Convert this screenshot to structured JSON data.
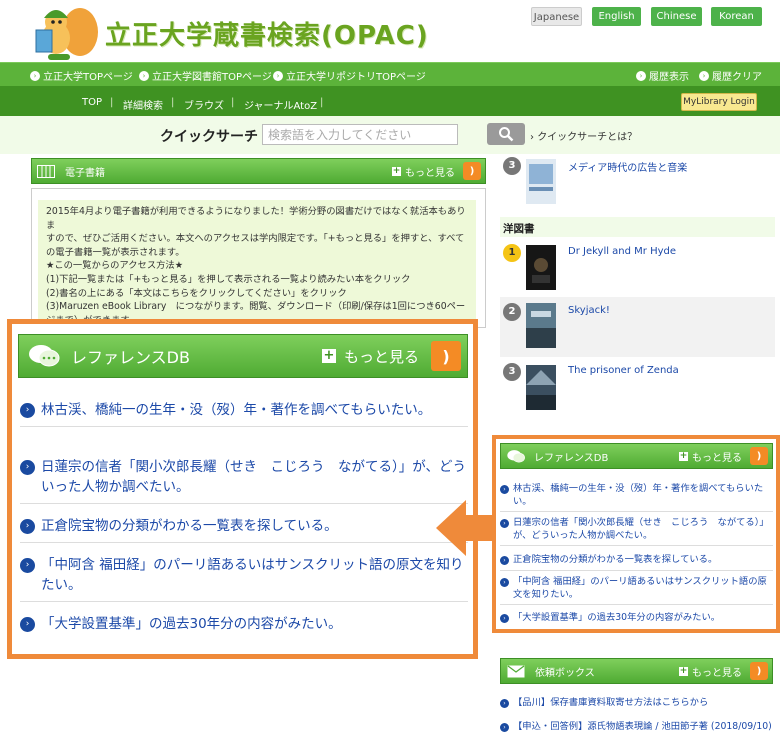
{
  "header": {
    "title": "立正大学蔵書検索(OPAC)",
    "languages": [
      "Japanese",
      "English",
      "Chinese",
      "Korean"
    ],
    "top_links": [
      "立正大学TOPページ",
      "立正大学図書館TOPページ",
      "立正大学リポジトリTOPページ"
    ],
    "right_links": [
      "履歴表示",
      "履歴クリア"
    ],
    "nav": [
      "TOP",
      "詳細検索",
      "ブラウズ",
      "ジャーナルAtoZ"
    ],
    "mylibrary": "MyLibrary Login"
  },
  "quick_search": {
    "label": "クイックサーチ",
    "placeholder": "検索語を入力してください",
    "about": "クイックサーチとは？"
  },
  "ebook": {
    "title": "電子書籍",
    "more": "もっと見る",
    "lines": [
      "2015年4月より電子書籍が利用できるようになりました！学術分野の図書だけではなく就活本もありま",
      "すので、ぜひご活用ください。本文へのアクセスは学内限定です。「+もっと見る」を押すと、すべて",
      "の電子書籍一覧が表示されます。",
      "★この一覧からのアクセス方法★",
      "(1)下記一覧または「+もっと見る」を押して表示される一覧より読みたい本をクリック",
      "(2)書名の上にある「本文はこちらをクリックしてください」をクリック",
      "(3)Maruzen eBook Library　につながります。閲覧、ダウンロード（印刷/保存は1回につき60ペー",
      "ジまで）ができます。"
    ]
  },
  "reference": {
    "title": "レファレンスDB",
    "more": "もっと見る",
    "items": [
      "林古渓、橋純一の生年・没（歿）年・著作を調べてもらいたい。",
      "日蓮宗の信者「関小次郎長耀（せき　こじろう　ながてる）」が、どういった人物か調べたい。",
      "正倉院宝物の分類がわかる一覧表を探している。",
      "「中阿含 福田経」のパーリ語あるいはサンスクリット語の原文を知りたい。",
      "「大学設置基準」の過去30年分の内容がみたい。"
    ]
  },
  "ranking": {
    "top": {
      "rank": "3",
      "title": "メディア時代の広告と音楽"
    },
    "section": "洋図書",
    "items": [
      {
        "rank": "1",
        "title": "Dr Jekyll and Mr Hyde"
      },
      {
        "rank": "2",
        "title": "Skyjack!"
      },
      {
        "rank": "3",
        "title": "The prisoner of Zenda"
      }
    ]
  },
  "request": {
    "title": "依頼ボックス",
    "more": "もっと見る",
    "items": [
      "【品川】保存書庫資料取寄せ方法はこちらから",
      "【申込・回答例】源氏物語表現論 / 池田節子著 (2018/09/10)"
    ]
  },
  "colors": {
    "accent_green": "#5cb33a",
    "highlight_orange": "#ef8a3a",
    "link_blue": "#1c49a8"
  }
}
